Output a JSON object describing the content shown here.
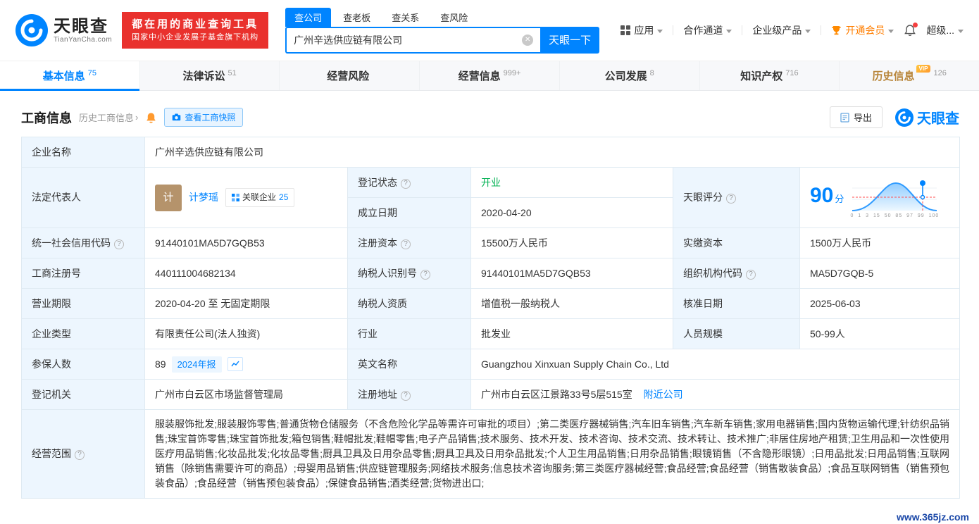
{
  "icons": {
    "clear": "✕",
    "chevron_right": "›"
  },
  "header": {
    "logo_text": "天眼查",
    "logo_domain": "TianYanCha.com",
    "slogan_line1": "都在用的商业查询工具",
    "slogan_line2": "国家中小企业发展子基金旗下机构",
    "search_tabs": [
      {
        "label": "查公司"
      },
      {
        "label": "查老板"
      },
      {
        "label": "查关系"
      },
      {
        "label": "查风险"
      }
    ],
    "search_value": "广州辛选供应链有限公司",
    "search_button": "天眼一下",
    "menu": {
      "app": "应用",
      "cooperation": "合作通道",
      "enterprise_product": "企业级产品",
      "vip": "开通会员",
      "super": "超级..."
    }
  },
  "nav": {
    "tabs": [
      {
        "label": "基本信息",
        "count": "75"
      },
      {
        "label": "法律诉讼",
        "count": "51"
      },
      {
        "label": "经营风险",
        "count": ""
      },
      {
        "label": "经营信息",
        "count": "999+"
      },
      {
        "label": "公司发展",
        "count": "8"
      },
      {
        "label": "知识产权",
        "count": "716"
      },
      {
        "label": "历史信息",
        "count": "126",
        "badge": "VIP"
      }
    ]
  },
  "section": {
    "title": "工商信息",
    "history_link": "历史工商信息",
    "snapshot_button": "查看工商快照",
    "export_button": "导出",
    "brand_watermark": "天眼查"
  },
  "info": {
    "labels": {
      "company_name": "企业名称",
      "legal_rep": "法定代表人",
      "reg_status": "登记状态",
      "establish_date": "成立日期",
      "score": "天眼评分",
      "credit_code": "统一社会信用代码",
      "reg_capital": "注册资本",
      "paid_capital": "实缴资本",
      "reg_number": "工商注册号",
      "taxpayer_id": "纳税人识别号",
      "org_code": "组织机构代码",
      "business_term": "营业期限",
      "taxpayer_quality": "纳税人资质",
      "approval_date": "核准日期",
      "company_type": "企业类型",
      "industry": "行业",
      "staff_size": "人员规模",
      "insured_count": "参保人数",
      "english_name": "英文名称",
      "reg_authority": "登记机关",
      "reg_address": "注册地址",
      "business_scope": "经营范围"
    },
    "values": {
      "company_name": "广州辛选供应链有限公司",
      "legal_rep_avatar": "计",
      "legal_rep": "计梦瑶",
      "related_companies_label": "关联企业",
      "related_companies_count": "25",
      "reg_status": "开业",
      "establish_date": "2020-04-20",
      "score": "90",
      "score_unit": "分",
      "score_axis": "0 1 3 15 50 85 97 99 100",
      "credit_code": "91440101MA5D7GQB53",
      "reg_capital": "15500万人民币",
      "paid_capital": "1500万人民币",
      "reg_number": "440111004682134",
      "taxpayer_id": "91440101MA5D7GQB53",
      "org_code": "MA5D7GQB-5",
      "business_term": "2020-04-20 至 无固定期限",
      "taxpayer_quality": "增值税一般纳税人",
      "approval_date": "2025-06-03",
      "company_type": "有限责任公司(法人独资)",
      "industry": "批发业",
      "staff_size": "50-99人",
      "insured_count": "89",
      "annual_report_link": "2024年报",
      "english_name": "Guangzhou Xinxuan Supply Chain Co., Ltd",
      "reg_authority": "广州市白云区市场监督管理局",
      "reg_address": "广州市白云区江景路33号5层515室",
      "nearby_link": "附近公司",
      "business_scope": "服装服饰批发;服装服饰零售;普通货物仓储服务（不含危险化学品等需许可审批的项目）;第二类医疗器械销售;汽车旧车销售;汽车新车销售;家用电器销售;国内货物运输代理;针纺织品销售;珠宝首饰零售;珠宝首饰批发;箱包销售;鞋帽批发;鞋帽零售;电子产品销售;技术服务、技术开发、技术咨询、技术交流、技术转让、技术推广;非居住房地产租赁;卫生用品和一次性使用医疗用品销售;化妆品批发;化妆品零售;厨具卫具及日用杂品零售;厨具卫具及日用杂品批发;个人卫生用品销售;日用杂品销售;眼镜销售（不含隐形眼镜）;日用品批发;日用品销售;互联网销售（除销售需要许可的商品）;母婴用品销售;供应链管理服务;网络技术服务;信息技术咨询服务;第三类医疗器械经营;食品经营;食品经营（销售散装食品）;食品互联网销售（销售预包装食品）;食品经营（销售预包装食品）;保健食品销售;酒类经营;货物进出口;"
    }
  },
  "footer": {
    "site": "www.365jz.com"
  }
}
